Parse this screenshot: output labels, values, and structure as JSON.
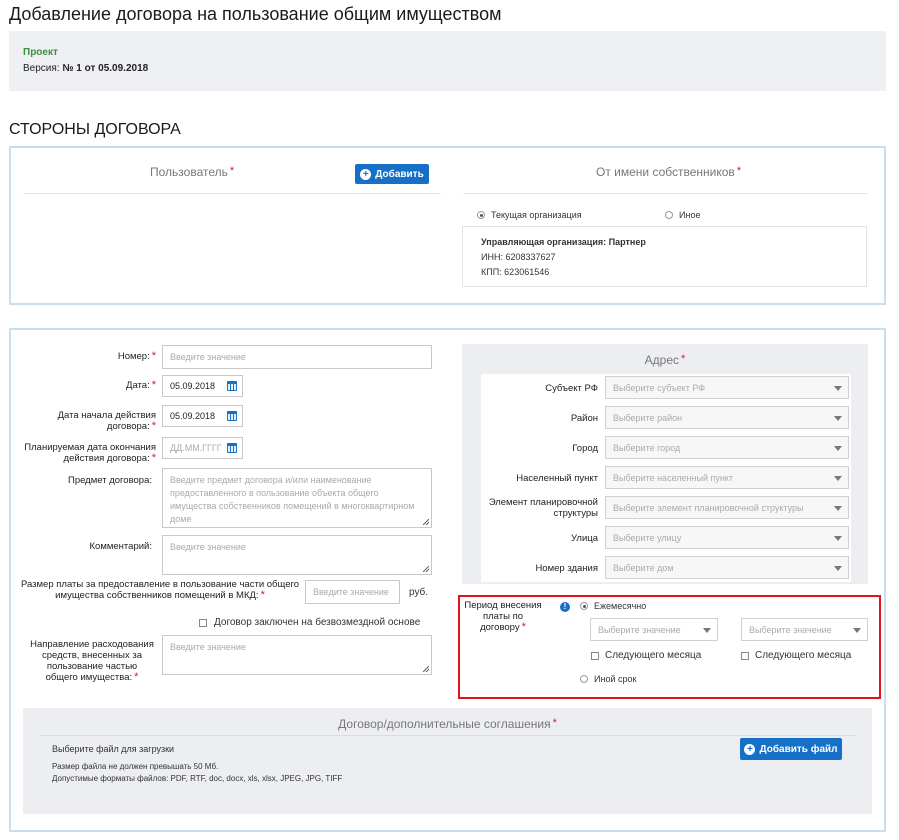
{
  "page": {
    "title": "Добавление договора на пользование общим имуществом",
    "status": "Проект",
    "version_label": "Версия:",
    "version_value": "№ 1 от 05.09.2018"
  },
  "parties": {
    "section_title": "СТОРОНЫ ДОГОВОРА",
    "user_label": "Пользователь",
    "add_button": "Добавить",
    "owners_label": "От имени собственников",
    "radio_current": "Текущая организация",
    "radio_other": "Иное",
    "org_name": "Управляющая организация: Партнер",
    "inn": "ИНН: 6208337627",
    "kpp": "КПП: 623061546",
    "required_mark": "*"
  },
  "form": {
    "number_label": "Номер:",
    "number_placeholder": "Введите значение",
    "date_label": "Дата:",
    "date_value": "05.09.2018",
    "start_label": "Дата начала действия договора:",
    "start_value": "05.09.2018",
    "end_label": "Планируемая дата окончания действия договора:",
    "end_placeholder": "ДД.ММ.ГГГГ",
    "subject_label": "Предмет договора:",
    "subject_placeholder": "Введите предмет договора и/или наименование предоставленного в пользование объекта общего имущества собственников помещений в многоквартирном доме",
    "comment_label": "Комментарий:",
    "comment_placeholder": "Введите значение",
    "fee_label": "Размер платы за предоставление в пользование части общего имущества собственников помещений в МКД:",
    "fee_placeholder": "Введите значение",
    "fee_unit": "руб.",
    "free_label": "Договор заключен на безвозмездной основе",
    "direction_label": "Направление расходования средств, внесенных за пользование частью общего имущества:",
    "direction_placeholder": "Введите значение"
  },
  "address": {
    "title": "Адрес",
    "fields": [
      {
        "label": "Субъект РФ",
        "placeholder": "Выберите субъект РФ"
      },
      {
        "label": "Район",
        "placeholder": "Выберите район"
      },
      {
        "label": "Город",
        "placeholder": "Выберите город"
      },
      {
        "label": "Населенный пункт",
        "placeholder": "Выберите населенный пункт"
      },
      {
        "label": "Элемент планировочной структуры",
        "placeholder": "Выберите элемент планировочной структуры"
      },
      {
        "label": "Улица",
        "placeholder": "Выберите улицу"
      },
      {
        "label": "Номер здания",
        "placeholder": "Выберите дом"
      }
    ]
  },
  "payment": {
    "label": "Период внесения платы по договору",
    "info_icon_text": "!",
    "monthly": "Ежемесячно",
    "select1_placeholder": "Выберите значение",
    "select2_placeholder": "Выберите значение",
    "next_month_1": "Следующего месяца",
    "next_month_2": "Следующего месяца",
    "other_term": "Иной срок"
  },
  "upload": {
    "title": "Договор/дополнительные соглашения",
    "choose": "Выберите файл для загрузки",
    "size_note": "Размер файла не должен превышать 50 Мб.",
    "formats_note": "Допустимые форматы файлов: PDF, RTF, doc, docx, xls, xlsx, JPEG, JPG, TIFF",
    "add_file_button": "Добавить файл"
  }
}
